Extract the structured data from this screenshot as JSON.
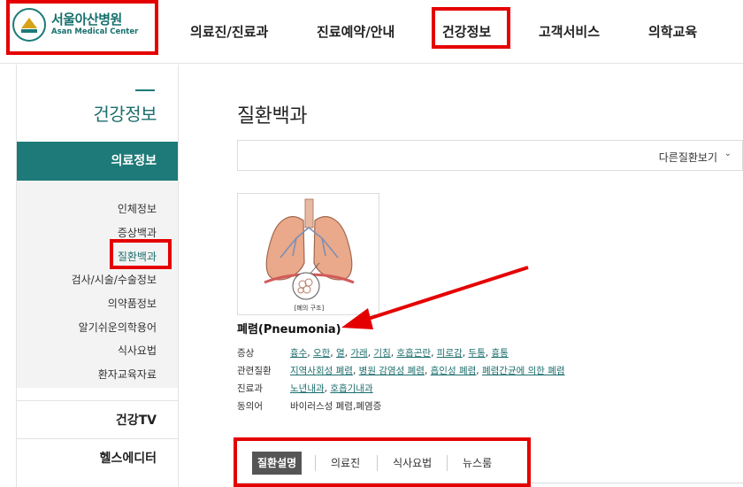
{
  "logo": {
    "ko": "서울아산병원",
    "en": "Asan Medical Center"
  },
  "gnb": [
    "의료진/진료과",
    "진료예약/안내",
    "건강정보",
    "고객서비스",
    "의학교육"
  ],
  "sidebar": {
    "title": "건강정보",
    "active": "의료정보",
    "sub": [
      "인체정보",
      "증상백과",
      "질환백과",
      "검사/시술/수술정보",
      "의약품정보",
      "알기쉬운의학용어",
      "식사요법",
      "환자교육자료"
    ],
    "active_sub": "질환백과",
    "main": [
      "건강TV",
      "헬스에디터"
    ]
  },
  "content": {
    "title": "질환백과",
    "other_select": "다른질환보기",
    "image_caption": "[폐의 구조]",
    "disease_name": "폐렴(Pneumonia)",
    "info": [
      {
        "k": "증상",
        "links": [
          "흉수",
          "오한",
          "열",
          "가래",
          "기침",
          "호흡곤란",
          "피로감",
          "두통",
          "흉통"
        ]
      },
      {
        "k": "관련질환",
        "links": [
          "지역사회성 폐렴",
          "병원 감염성 폐렴",
          "흡인성 폐렴",
          "폐렴간균에 의한 폐렴"
        ]
      },
      {
        "k": "진료과",
        "links": [
          "노년내과",
          "호흡기내과"
        ]
      },
      {
        "k": "동의어",
        "text": "바이러스성 폐렴,폐염증"
      }
    ],
    "tabs": [
      "질환설명",
      "의료진",
      "식사요법",
      "뉴스룸"
    ]
  },
  "colors": {
    "brand": "#1d7a78",
    "annotation": "#e50000"
  }
}
